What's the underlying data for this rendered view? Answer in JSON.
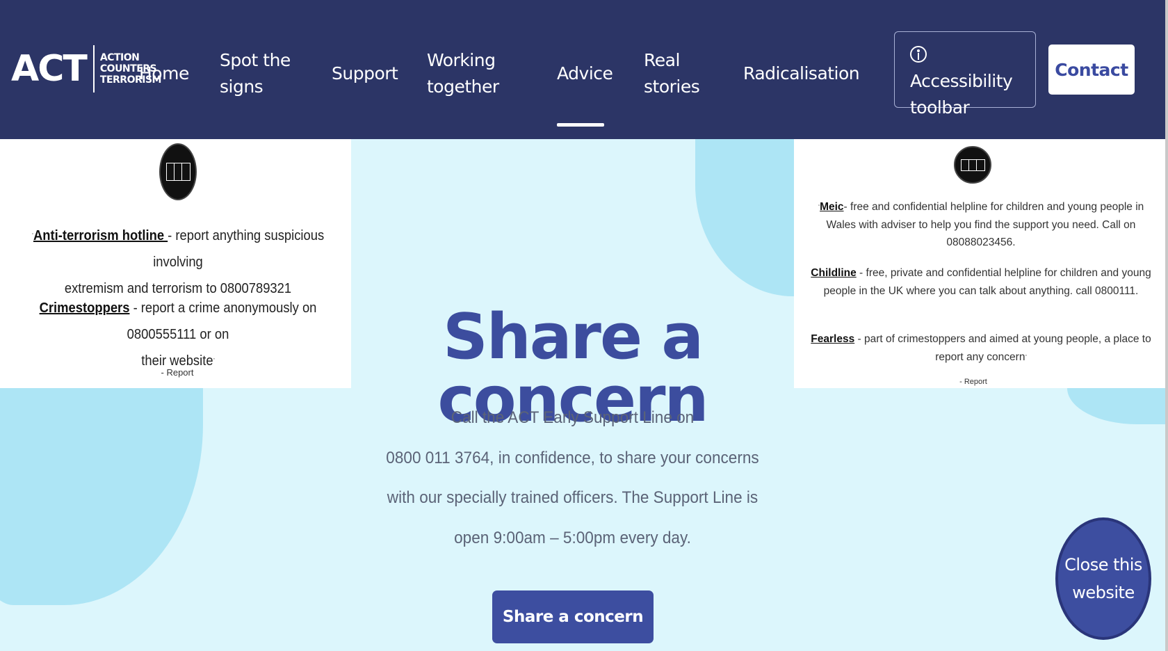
{
  "logo": {
    "mark": "ACT",
    "words": [
      "ACTION",
      "COUNTERS",
      "TERRORISM"
    ]
  },
  "nav": {
    "home": "Home",
    "spot_line1": "Spot the",
    "spot_line2": "signs",
    "support": "Support",
    "working_line1": "Working",
    "working_line2": "together",
    "advice": "Advice",
    "real_line1": "Real",
    "real_line2": "stories",
    "radicalisation": "Radicalisation",
    "accessibility_line1": "Accessibility",
    "accessibility_line2": "toolbar",
    "contact": "Contact",
    "active": "Advice"
  },
  "left_popup": {
    "badge_icon": "run-hide-tell-icon",
    "hotline_link": "Anti-terrorism hotline ",
    "hotline_text_1": " - report anything suspicious involving",
    "hotline_text_2": "extremism and terrorism to 0800789321",
    "crimestoppers_link": "Crimestoppers",
    "crimestoppers_text_1": " - report a crime anonymously on 0800555111 or on",
    "crimestoppers_text_2": "their website",
    "report": "- Report"
  },
  "right_popup": {
    "badge_icon": "run-hide-tell-icon",
    "meic_link": "Meic",
    "meic_text": "- free and confidential helpline for children and young people in Wales with adviser to help you find the support you need. Call on 08088023456.",
    "childline_link": "Childline",
    "childline_text": " - free, private and confidential helpline for children and young people in the UK where you can talk about anything. call 0800111.",
    "fearless_link": "Fearless",
    "fearless_text": " - part of crimestoppers and aimed at young people, a place to report any concern",
    "report": "- Report"
  },
  "main": {
    "title": "Share a concern",
    "line1": "Call the ACT Early Support Line on",
    "line2": "0800 011 3764, in confidence, to share your concerns",
    "line3": "with our specially trained officers. The Support Line is",
    "line4": "open 9:00am – 5:00pm every day.",
    "button": "Share a concern"
  },
  "close_website": {
    "line1": "Close this",
    "line2": "website"
  },
  "colors": {
    "header": "#2c3566",
    "accent": "#3c4d9e",
    "background": "#dcf6fc",
    "blob": "#ade5f5"
  }
}
